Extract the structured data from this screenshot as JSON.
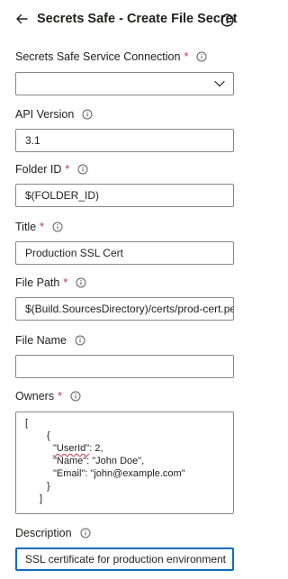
{
  "header": {
    "title": "Secrets Safe - Create File Secret"
  },
  "fields": {
    "connection": {
      "label": "Secrets Safe Service Connection",
      "value": ""
    },
    "api_version": {
      "label": "API Version",
      "value": "3.1"
    },
    "folder_id": {
      "label": "Folder ID",
      "value": "$(FOLDER_ID)"
    },
    "title": {
      "label": "Title",
      "value": "Production SSL Cert"
    },
    "file_path": {
      "label": "File Path",
      "value": "$(Build.SourcesDirectory)/certs/prod-cert.pem"
    },
    "file_name": {
      "label": "File Name",
      "value": ""
    },
    "owners": {
      "label": "Owners",
      "lines": {
        "open_bracket": "[",
        "open_brace": "{",
        "userid_key": "\"UserId\"",
        "userid_rest": ": 2,",
        "name": "\"Name\": \"John Doe\",",
        "email": "\"Email\": \"john@example.com\"",
        "close_brace": "}",
        "close_bracket": "]"
      }
    },
    "description": {
      "label": "Description",
      "value": "SSL certificate for production environment"
    }
  },
  "required_marker": "*",
  "colors": {
    "accent": "#0f6cbd",
    "required": "#c4314b",
    "border": "#8a8886"
  },
  "icons": {
    "back": "arrow-left-icon",
    "info": "info-icon",
    "dropdown": "chevron-down-icon"
  }
}
